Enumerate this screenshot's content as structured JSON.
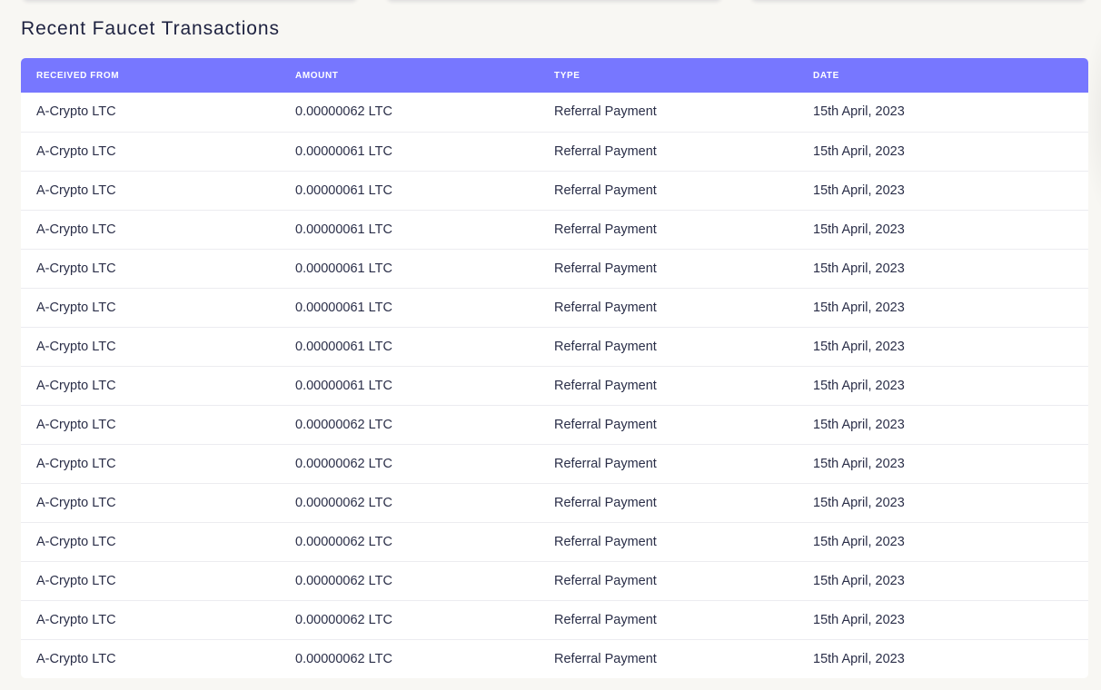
{
  "page": {
    "title": "Recent Faucet Transactions"
  },
  "table": {
    "headers": {
      "received_from": "RECEIVED FROM",
      "amount": "AMOUNT",
      "type": "TYPE",
      "date": "DATE"
    },
    "rows": [
      {
        "received_from": "A-Crypto LTC",
        "amount": "0.00000062 LTC",
        "type": "Referral Payment",
        "date": "15th April, 2023"
      },
      {
        "received_from": "A-Crypto LTC",
        "amount": "0.00000061 LTC",
        "type": "Referral Payment",
        "date": "15th April, 2023"
      },
      {
        "received_from": "A-Crypto LTC",
        "amount": "0.00000061 LTC",
        "type": "Referral Payment",
        "date": "15th April, 2023"
      },
      {
        "received_from": "A-Crypto LTC",
        "amount": "0.00000061 LTC",
        "type": "Referral Payment",
        "date": "15th April, 2023"
      },
      {
        "received_from": "A-Crypto LTC",
        "amount": "0.00000061 LTC",
        "type": "Referral Payment",
        "date": "15th April, 2023"
      },
      {
        "received_from": "A-Crypto LTC",
        "amount": "0.00000061 LTC",
        "type": "Referral Payment",
        "date": "15th April, 2023"
      },
      {
        "received_from": "A-Crypto LTC",
        "amount": "0.00000061 LTC",
        "type": "Referral Payment",
        "date": "15th April, 2023"
      },
      {
        "received_from": "A-Crypto LTC",
        "amount": "0.00000061 LTC",
        "type": "Referral Payment",
        "date": "15th April, 2023"
      },
      {
        "received_from": "A-Crypto LTC",
        "amount": "0.00000062 LTC",
        "type": "Referral Payment",
        "date": "15th April, 2023"
      },
      {
        "received_from": "A-Crypto LTC",
        "amount": "0.00000062 LTC",
        "type": "Referral Payment",
        "date": "15th April, 2023"
      },
      {
        "received_from": "A-Crypto LTC",
        "amount": "0.00000062 LTC",
        "type": "Referral Payment",
        "date": "15th April, 2023"
      },
      {
        "received_from": "A-Crypto LTC",
        "amount": "0.00000062 LTC",
        "type": "Referral Payment",
        "date": "15th April, 2023"
      },
      {
        "received_from": "A-Crypto LTC",
        "amount": "0.00000062 LTC",
        "type": "Referral Payment",
        "date": "15th April, 2023"
      },
      {
        "received_from": "A-Crypto LTC",
        "amount": "0.00000062 LTC",
        "type": "Referral Payment",
        "date": "15th April, 2023"
      },
      {
        "received_from": "A-Crypto LTC",
        "amount": "0.00000062 LTC",
        "type": "Referral Payment",
        "date": "15th April, 2023"
      }
    ]
  },
  "colors": {
    "header_bg": "#7777ff",
    "page_bg": "#f8f7f3",
    "text": "#1e2240"
  }
}
